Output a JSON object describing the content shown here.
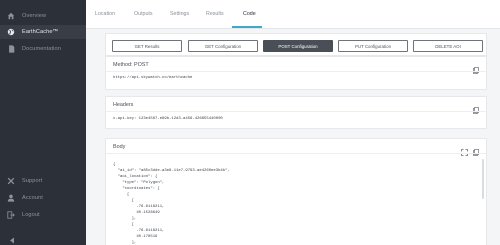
{
  "sidebar": {
    "items": [
      {
        "label": "Overview",
        "icon": "home-icon"
      },
      {
        "label": "EarthCache™",
        "icon": "globe-icon"
      },
      {
        "label": "Documentation",
        "icon": "document-icon"
      },
      {
        "label": "Support",
        "icon": "tools-icon"
      },
      {
        "label": "Account",
        "icon": "user-icon"
      },
      {
        "label": "Logout",
        "icon": "logout-icon"
      }
    ],
    "collapse_icon": "caret-left-icon"
  },
  "tabs": [
    {
      "label": "Location"
    },
    {
      "label": "Outputs"
    },
    {
      "label": "Settings"
    },
    {
      "label": "Results"
    },
    {
      "label": "Code"
    }
  ],
  "active_tab": "Code",
  "methods": [
    {
      "label": "GET Results"
    },
    {
      "label": "GET Configuration"
    },
    {
      "label": "POST Configuration"
    },
    {
      "label": "PUT Configuration"
    },
    {
      "label": "DELETE AOI"
    }
  ],
  "active_method": "POST Configuration",
  "method_card": {
    "title": "Method: POST",
    "url": "https://api.skywatch.co/earthcache"
  },
  "headers_card": {
    "title": "Headers",
    "value": "x-api-key: 123e4567-e89b-12d3-a456-426655440000"
  },
  "body_card": {
    "title": "Body",
    "code": "{\n  \"ai_id\": \"a85c3dde-a3e8-11e7-9793-ae4260ee3b4b\",\n  \"aoi_location\": {\n    \"type\": \"Polygon\",\n    \"coordinates\": [\n      [\n        [\n          -76.6118211,\n          40.1528649\n        ],\n        [\n          -76.6118211,\n          40.178519\n        ],\n        ["
  },
  "colors": {
    "sidebar": "#2c3038",
    "accent": "#3fa9c6",
    "active_button": "#4a4f57"
  }
}
